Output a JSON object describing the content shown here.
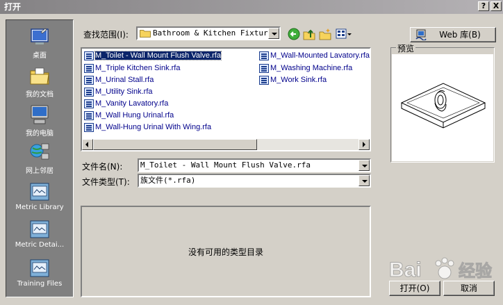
{
  "window": {
    "title": "打开",
    "help_btn": "?",
    "close_btn": "X"
  },
  "places": [
    {
      "label": "桌面",
      "icon": "desktop-icon"
    },
    {
      "label": "我的文档",
      "icon": "my-documents-icon"
    },
    {
      "label": "我的电脑",
      "icon": "my-computer-icon"
    },
    {
      "label": "网上邻居",
      "icon": "network-icon"
    },
    {
      "label": "Metric Library",
      "icon": "folder-icon"
    },
    {
      "label": "Metric Detai...",
      "icon": "folder-icon"
    },
    {
      "label": "Training Files",
      "icon": "folder-icon"
    }
  ],
  "lookin": {
    "label": "查找范围(I):",
    "value": "Bathroom & Kitchen Fixtures"
  },
  "weblib": {
    "label": "Web 库(B)"
  },
  "files": {
    "col1": [
      "M_Toilet - Wall Mount Flush Valve.rfa",
      "M_Triple Kitchen Sink.rfa",
      "M_Urinal Stall.rfa",
      "M_Utility Sink.rfa",
      "M_Vanity Lavatory.rfa",
      "M_Wall Hung Urinal.rfa",
      "M_Wall-Hung Urinal With Wing.rfa"
    ],
    "col2": [
      "M_Wall-Mounted Lavatory.rfa",
      "M_Washing Machine.rfa",
      "M_Work Sink.rfa"
    ]
  },
  "filename": {
    "label": "文件名(N):",
    "value": "M_Toilet - Wall Mount Flush Valve.rfa"
  },
  "filetype": {
    "label": "文件类型(T):",
    "value": "族文件(*.rfa)"
  },
  "typecatalog": {
    "message": "没有可用的类型目录"
  },
  "preview": {
    "label": "预览"
  },
  "buttons": {
    "open": "打开(O)",
    "cancel": "取消"
  },
  "watermark": {
    "text": "Bai",
    "text2": "经验"
  }
}
